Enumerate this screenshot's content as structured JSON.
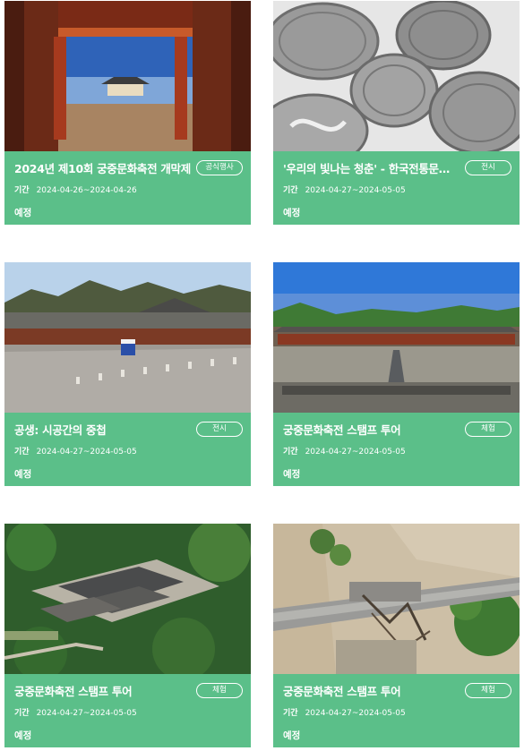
{
  "cards": [
    {
      "title": "2024년 제10회 궁중문화축전 개막제",
      "badge": "공식행사",
      "period_label": "기간",
      "period": "2024-04-26~2024-04-26",
      "status": "예정",
      "image_icon": "palace-gate-night-photo"
    },
    {
      "title": "'우리의 빛나는 청춘' - 한국전통문…",
      "badge": "전시",
      "period_label": "기간",
      "period": "2024-04-27~2024-05-05",
      "status": "예정",
      "image_icon": "silver-plates-photo"
    },
    {
      "title": "공생: 시공간의 중첩",
      "badge": "전시",
      "period_label": "기간",
      "period": "2024-04-27~2024-05-05",
      "status": "예정",
      "image_icon": "palace-courtyard-photo"
    },
    {
      "title": "궁중문화축전 스탬프 투어",
      "badge": "체험",
      "period_label": "기간",
      "period": "2024-04-27~2024-05-05",
      "status": "예정",
      "image_icon": "shrine-hall-photo"
    },
    {
      "title": "궁중문화축전 스탬프 투어",
      "badge": "체험",
      "period_label": "기간",
      "period": "2024-04-27~2024-05-05",
      "status": "예정",
      "image_icon": "palace-aerial-forest-photo"
    },
    {
      "title": "궁중문화축전 스탬프 투어",
      "badge": "체험",
      "period_label": "기간",
      "period": "2024-04-27~2024-05-05",
      "status": "예정",
      "image_icon": "stone-bridge-aerial-photo"
    }
  ],
  "colors": {
    "card_info_bg": "#5bbf89",
    "text": "#ffffff"
  }
}
